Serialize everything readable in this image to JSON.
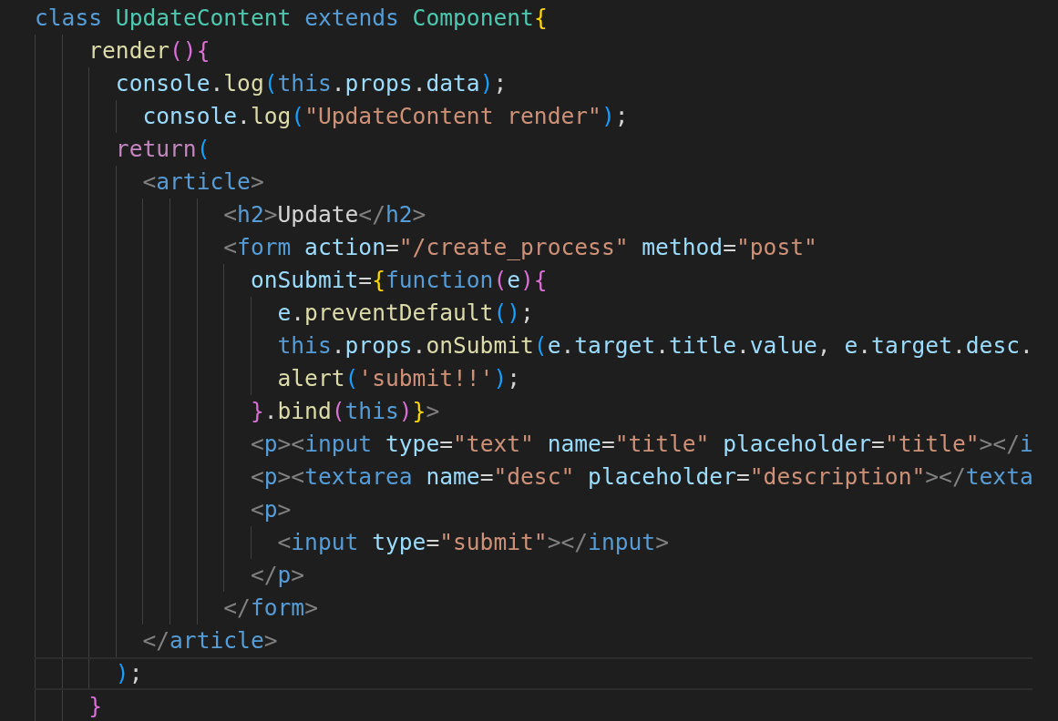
{
  "editor": {
    "lines": [
      {
        "current": false,
        "tokens": [
          {
            "text": "class",
            "kind": "keyword"
          },
          {
            "text": " UpdateContent",
            "kind": "type"
          },
          {
            "text": " extends",
            "kind": "keyword"
          },
          {
            "text": " Component",
            "kind": "type"
          },
          {
            "text": "{",
            "kind": "bracket1"
          }
        ]
      },
      {
        "current": false,
        "tokens": [
          {
            "text": "    render",
            "kind": "function"
          },
          {
            "text": "(){",
            "kind": "bracket2"
          }
        ]
      },
      {
        "current": false,
        "tokens": [
          {
            "text": "      console",
            "kind": "variable"
          },
          {
            "text": ".",
            "kind": "plain"
          },
          {
            "text": "log",
            "kind": "function"
          },
          {
            "text": "(",
            "kind": "bracket3"
          },
          {
            "text": "this",
            "kind": "keyword"
          },
          {
            "text": ".",
            "kind": "plain"
          },
          {
            "text": "props",
            "kind": "variable"
          },
          {
            "text": ".",
            "kind": "plain"
          },
          {
            "text": "data",
            "kind": "variable"
          },
          {
            "text": ")",
            "kind": "bracket3"
          },
          {
            "text": ";",
            "kind": "plain"
          }
        ]
      },
      {
        "current": false,
        "tokens": [
          {
            "text": "        console",
            "kind": "variable"
          },
          {
            "text": ".",
            "kind": "plain"
          },
          {
            "text": "log",
            "kind": "function"
          },
          {
            "text": "(",
            "kind": "bracket3"
          },
          {
            "text": "\"UpdateContent render\"",
            "kind": "string"
          },
          {
            "text": ")",
            "kind": "bracket3"
          },
          {
            "text": ";",
            "kind": "plain"
          }
        ]
      },
      {
        "current": false,
        "tokens": [
          {
            "text": "      return",
            "kind": "control"
          },
          {
            "text": "(",
            "kind": "bracket3"
          }
        ]
      },
      {
        "current": false,
        "tokens": [
          {
            "text": "        <",
            "kind": "tag"
          },
          {
            "text": "article",
            "kind": "tagname"
          },
          {
            "text": ">",
            "kind": "tag"
          }
        ]
      },
      {
        "current": false,
        "tokens": [
          {
            "text": "              <",
            "kind": "tag"
          },
          {
            "text": "h2",
            "kind": "tagname"
          },
          {
            "text": ">",
            "kind": "tag"
          },
          {
            "text": "Update",
            "kind": "plain"
          },
          {
            "text": "</",
            "kind": "tag"
          },
          {
            "text": "h2",
            "kind": "tagname"
          },
          {
            "text": ">",
            "kind": "tag"
          }
        ]
      },
      {
        "current": false,
        "tokens": [
          {
            "text": "              <",
            "kind": "tag"
          },
          {
            "text": "form",
            "kind": "tagname"
          },
          {
            "text": " action",
            "kind": "attribute"
          },
          {
            "text": "=",
            "kind": "plain"
          },
          {
            "text": "\"/create_process\"",
            "kind": "string"
          },
          {
            "text": " method",
            "kind": "attribute"
          },
          {
            "text": "=",
            "kind": "plain"
          },
          {
            "text": "\"post\"",
            "kind": "string"
          }
        ]
      },
      {
        "current": false,
        "tokens": [
          {
            "text": "                onSubmit",
            "kind": "attribute"
          },
          {
            "text": "=",
            "kind": "plain"
          },
          {
            "text": "{",
            "kind": "bracket1"
          },
          {
            "text": "function",
            "kind": "keyword"
          },
          {
            "text": "(",
            "kind": "bracket2"
          },
          {
            "text": "e",
            "kind": "variable"
          },
          {
            "text": "){",
            "kind": "bracket2"
          }
        ]
      },
      {
        "current": false,
        "tokens": [
          {
            "text": "                  e",
            "kind": "variable"
          },
          {
            "text": ".",
            "kind": "plain"
          },
          {
            "text": "preventDefault",
            "kind": "function"
          },
          {
            "text": "()",
            "kind": "bracket3"
          },
          {
            "text": ";",
            "kind": "plain"
          }
        ]
      },
      {
        "current": false,
        "tokens": [
          {
            "text": "                  this",
            "kind": "keyword"
          },
          {
            "text": ".",
            "kind": "plain"
          },
          {
            "text": "props",
            "kind": "variable"
          },
          {
            "text": ".",
            "kind": "plain"
          },
          {
            "text": "onSubmit",
            "kind": "function"
          },
          {
            "text": "(",
            "kind": "bracket3"
          },
          {
            "text": "e",
            "kind": "variable"
          },
          {
            "text": ".",
            "kind": "plain"
          },
          {
            "text": "target",
            "kind": "variable"
          },
          {
            "text": ".",
            "kind": "plain"
          },
          {
            "text": "title",
            "kind": "variable"
          },
          {
            "text": ".",
            "kind": "plain"
          },
          {
            "text": "value",
            "kind": "variable"
          },
          {
            "text": ",",
            "kind": "plain"
          },
          {
            "text": " e",
            "kind": "variable"
          },
          {
            "text": ".",
            "kind": "plain"
          },
          {
            "text": "target",
            "kind": "variable"
          },
          {
            "text": ".",
            "kind": "plain"
          },
          {
            "text": "desc",
            "kind": "variable"
          },
          {
            "text": ".",
            "kind": "plain"
          }
        ]
      },
      {
        "current": false,
        "tokens": [
          {
            "text": "                  alert",
            "kind": "function"
          },
          {
            "text": "(",
            "kind": "bracket3"
          },
          {
            "text": "'submit!!'",
            "kind": "string"
          },
          {
            "text": ")",
            "kind": "bracket3"
          },
          {
            "text": ";",
            "kind": "plain"
          }
        ]
      },
      {
        "current": false,
        "tokens": [
          {
            "text": "                }",
            "kind": "bracket2"
          },
          {
            "text": ".",
            "kind": "plain"
          },
          {
            "text": "bind",
            "kind": "function"
          },
          {
            "text": "(",
            "kind": "bracket2"
          },
          {
            "text": "this",
            "kind": "keyword"
          },
          {
            "text": ")",
            "kind": "bracket2"
          },
          {
            "text": "}",
            "kind": "bracket1"
          },
          {
            "text": ">",
            "kind": "tag"
          }
        ]
      },
      {
        "current": false,
        "tokens": [
          {
            "text": "                <",
            "kind": "tag"
          },
          {
            "text": "p",
            "kind": "tagname"
          },
          {
            "text": "><",
            "kind": "tag"
          },
          {
            "text": "input",
            "kind": "tagname"
          },
          {
            "text": " type",
            "kind": "attribute"
          },
          {
            "text": "=",
            "kind": "plain"
          },
          {
            "text": "\"text\"",
            "kind": "string"
          },
          {
            "text": " name",
            "kind": "attribute"
          },
          {
            "text": "=",
            "kind": "plain"
          },
          {
            "text": "\"title\"",
            "kind": "string"
          },
          {
            "text": " placeholder",
            "kind": "attribute"
          },
          {
            "text": "=",
            "kind": "plain"
          },
          {
            "text": "\"title\"",
            "kind": "string"
          },
          {
            "text": "></",
            "kind": "tag"
          },
          {
            "text": "i",
            "kind": "tagname"
          }
        ]
      },
      {
        "current": false,
        "tokens": [
          {
            "text": "                <",
            "kind": "tag"
          },
          {
            "text": "p",
            "kind": "tagname"
          },
          {
            "text": "><",
            "kind": "tag"
          },
          {
            "text": "textarea",
            "kind": "tagname"
          },
          {
            "text": " name",
            "kind": "attribute"
          },
          {
            "text": "=",
            "kind": "plain"
          },
          {
            "text": "\"desc\"",
            "kind": "string"
          },
          {
            "text": " placeholder",
            "kind": "attribute"
          },
          {
            "text": "=",
            "kind": "plain"
          },
          {
            "text": "\"description\"",
            "kind": "string"
          },
          {
            "text": "></",
            "kind": "tag"
          },
          {
            "text": "texta",
            "kind": "tagname"
          }
        ]
      },
      {
        "current": false,
        "tokens": [
          {
            "text": "                <",
            "kind": "tag"
          },
          {
            "text": "p",
            "kind": "tagname"
          },
          {
            "text": ">",
            "kind": "tag"
          }
        ]
      },
      {
        "current": false,
        "tokens": [
          {
            "text": "                  <",
            "kind": "tag"
          },
          {
            "text": "input",
            "kind": "tagname"
          },
          {
            "text": " type",
            "kind": "attribute"
          },
          {
            "text": "=",
            "kind": "plain"
          },
          {
            "text": "\"submit\"",
            "kind": "string"
          },
          {
            "text": "></",
            "kind": "tag"
          },
          {
            "text": "input",
            "kind": "tagname"
          },
          {
            "text": ">",
            "kind": "tag"
          }
        ]
      },
      {
        "current": false,
        "tokens": [
          {
            "text": "                </",
            "kind": "tag"
          },
          {
            "text": "p",
            "kind": "tagname"
          },
          {
            "text": ">",
            "kind": "tag"
          }
        ]
      },
      {
        "current": false,
        "tokens": [
          {
            "text": "              </",
            "kind": "tag"
          },
          {
            "text": "form",
            "kind": "tagname"
          },
          {
            "text": ">",
            "kind": "tag"
          }
        ]
      },
      {
        "current": false,
        "tokens": [
          {
            "text": "        </",
            "kind": "tag"
          },
          {
            "text": "article",
            "kind": "tagname"
          },
          {
            "text": ">",
            "kind": "tag"
          }
        ]
      },
      {
        "current": true,
        "tokens": [
          {
            "text": "      )",
            "kind": "bracket3"
          },
          {
            "text": ";",
            "kind": "plain"
          }
        ]
      },
      {
        "current": false,
        "tokens": [
          {
            "text": "    }",
            "kind": "bracket2"
          }
        ]
      }
    ]
  }
}
